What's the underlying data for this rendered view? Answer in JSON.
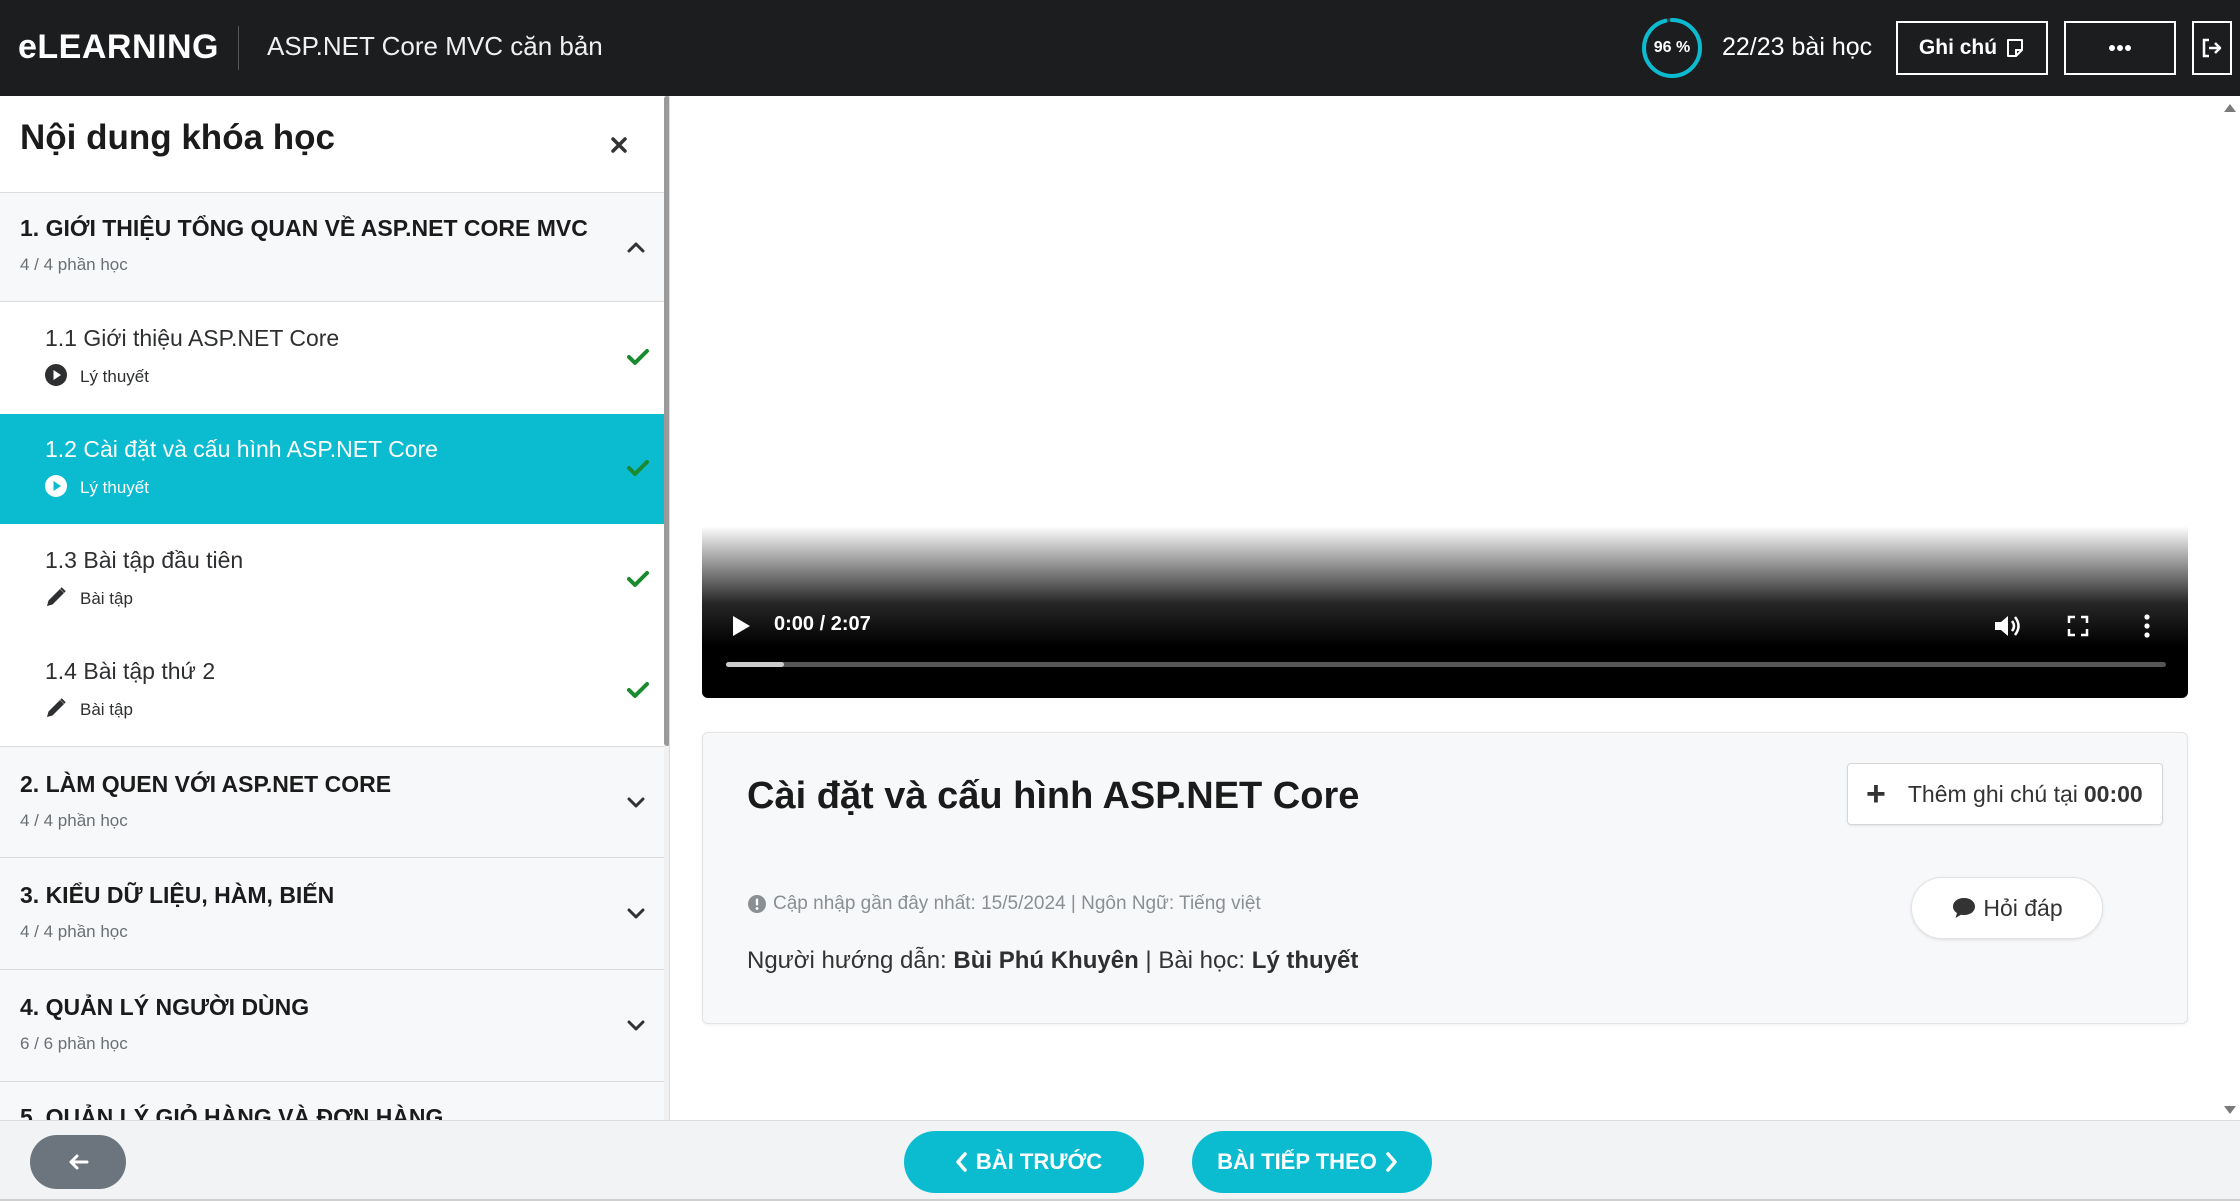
{
  "header": {
    "logo": "eLEARNING",
    "course_title": "ASP.NET Core MVC căn bản",
    "progress_percent_label": "96 %",
    "progress_value": 0.96,
    "lessons_count": "22/23 bài học",
    "note_button": "Ghi chú",
    "more_icon": "ellipsis-icon",
    "exit_icon": "sign-out-icon"
  },
  "sidebar": {
    "title": "Nội dung khóa học",
    "sections": [
      {
        "title": "1. GIỚI THIỆU TỔNG QUAN VỀ ASP.NET CORE MVC",
        "sub": "4 / 4 phần học",
        "expanded": true
      },
      {
        "title": "2. LÀM QUEN VỚI ASP.NET CORE",
        "sub": "4 / 4 phần học",
        "expanded": false
      },
      {
        "title": "3. KIỂU DỮ LIỆU, HÀM, BIẾN",
        "sub": "4 / 4 phần học",
        "expanded": false
      },
      {
        "title": "4. QUẢN LÝ NGƯỜI DÙNG",
        "sub": "6 / 6 phần học",
        "expanded": false
      },
      {
        "title": "5. QUẢN LÝ GIỎ HÀNG VÀ ĐƠN HÀNG",
        "sub": "",
        "expanded": false
      }
    ],
    "lessons": [
      {
        "title": "1.1 Giới thiệu ASP.NET Core",
        "type": "Lý thuyết",
        "icon": "play-circle-icon",
        "done": true,
        "active": false
      },
      {
        "title": "1.2 Cài đặt và cấu hình ASP.NET Core",
        "type": "Lý thuyết",
        "icon": "play-circle-icon",
        "done": true,
        "active": true
      },
      {
        "title": "1.3 Bài tập đầu tiên",
        "type": "Bài tập",
        "icon": "pencil-icon",
        "done": true,
        "active": false
      },
      {
        "title": "1.4 Bài tập thứ 2",
        "type": "Bài tập",
        "icon": "pencil-icon",
        "done": true,
        "active": false
      }
    ]
  },
  "video": {
    "time": "0:00 / 2:07",
    "played_fraction": 0.04
  },
  "lesson_info": {
    "heading": "Cài đặt và cấu hình ASP.NET Core",
    "add_note_label": "Thêm ghi chú tại",
    "add_note_time": "00:00",
    "meta": "Cập nhập gần đây nhất: 15/5/2024 | Ngôn Ngữ: Tiếng việt",
    "instructor_label": "Người hướng dẫn:",
    "instructor_name": "Bùi Phú Khuyên",
    "separator": "|",
    "lesson_label": "Bài học:",
    "lesson_type": "Lý thuyết",
    "qa_button": "Hỏi đáp"
  },
  "footer": {
    "prev_label": "BÀI TRƯỚC",
    "next_label": "BÀI TIẾP THEO"
  },
  "colors": {
    "accent": "#0bbcd0",
    "header_bg": "#1c1d1f",
    "check": "#1a8a2e"
  }
}
